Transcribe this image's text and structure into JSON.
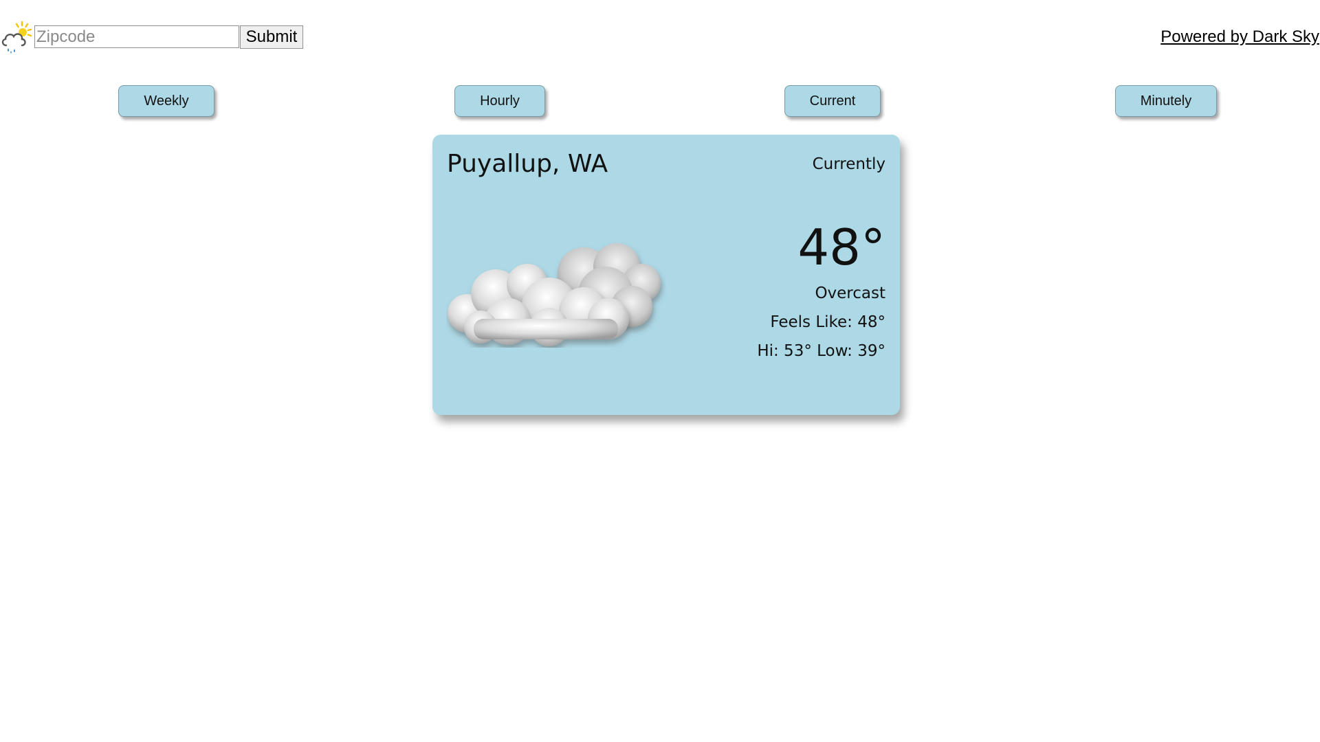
{
  "search": {
    "placeholder": "Zipcode",
    "value": "",
    "submit_label": "Submit"
  },
  "header": {
    "logo_icon": "weather-logo-icon",
    "powered_by_label": "Powered by Dark Sky"
  },
  "views": {
    "weekly_label": "Weekly",
    "hourly_label": "Hourly",
    "current_label": "Current",
    "minutely_label": "Minutely"
  },
  "card": {
    "location": "Puyallup, WA",
    "period": "Currently",
    "icon": "cloud-icon",
    "temperature": "48°",
    "summary": "Overcast",
    "feels_like": "Feels Like: 48°",
    "hi_low": "Hi: 53° Low: 39°"
  },
  "colors": {
    "card_background": "#add8e6",
    "button_background": "#add8e6",
    "page_background": "#ffffff"
  }
}
